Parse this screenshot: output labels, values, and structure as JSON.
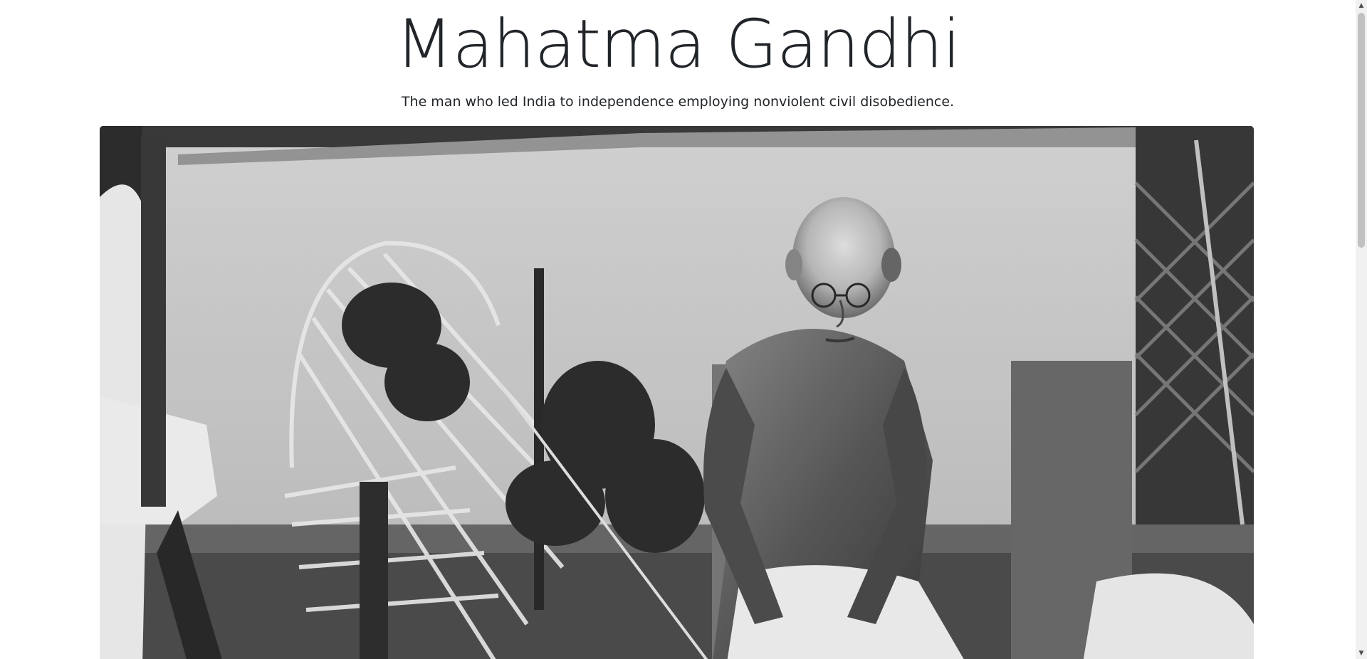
{
  "header": {
    "title": "Mahatma Gandhi",
    "subtitle": "The man who led India to independence employing nonviolent civil disobedience."
  },
  "main": {
    "image": {
      "description_icon": "portrait-photo",
      "style": "black-and-white"
    }
  },
  "scrollbar": {
    "up_arrow": "▲",
    "down_arrow": "▼"
  },
  "colors": {
    "text": "#212529",
    "background": "#ffffff",
    "scrollbar_track": "#f1f1f1",
    "scrollbar_thumb": "#c1c1c1"
  }
}
